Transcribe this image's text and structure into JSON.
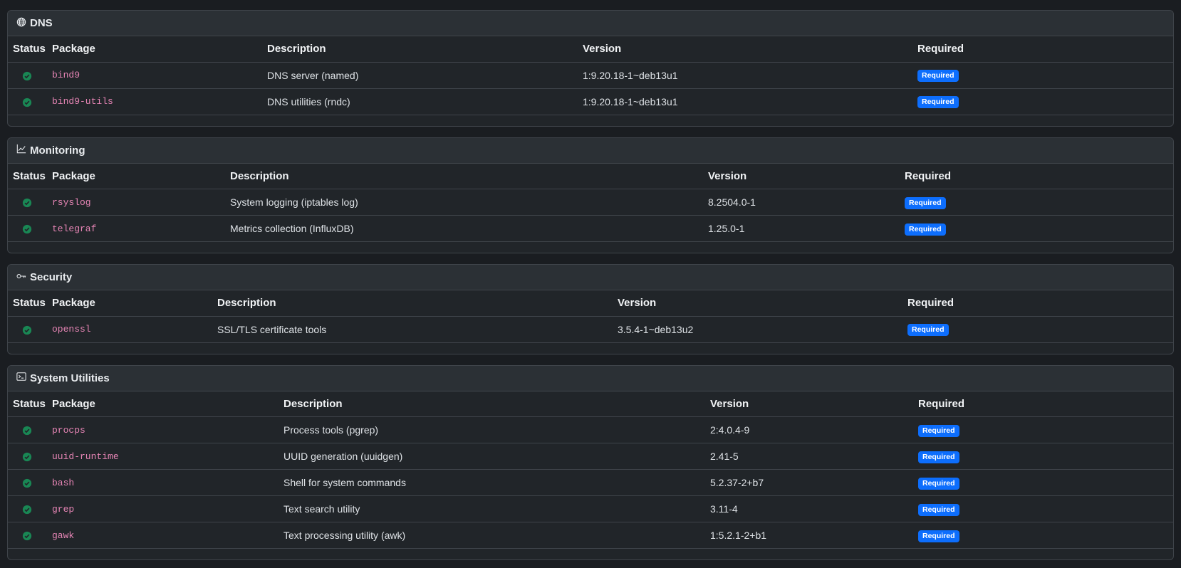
{
  "sections": [
    {
      "title": "DNS",
      "icon": "globe-icon",
      "headers": {
        "status": "Status",
        "package": "Package",
        "description": "Description",
        "version": "Version",
        "required": "Required"
      },
      "rows": [
        {
          "package": "bind9",
          "description": "DNS server (named)",
          "version": "1:9.20.18-1~deb13u1",
          "badge": "Required"
        },
        {
          "package": "bind9-utils",
          "description": "DNS utilities (rndc)",
          "version": "1:9.20.18-1~deb13u1",
          "badge": "Required"
        }
      ]
    },
    {
      "title": "Monitoring",
      "icon": "graph-up-icon",
      "headers": {
        "status": "Status",
        "package": "Package",
        "description": "Description",
        "version": "Version",
        "required": "Required"
      },
      "rows": [
        {
          "package": "rsyslog",
          "description": "System logging (iptables log)",
          "version": "8.2504.0-1",
          "badge": "Required"
        },
        {
          "package": "telegraf",
          "description": "Metrics collection (InfluxDB)",
          "version": "1.25.0-1",
          "badge": "Required"
        }
      ]
    },
    {
      "title": "Security",
      "icon": "key-icon",
      "headers": {
        "status": "Status",
        "package": "Package",
        "description": "Description",
        "version": "Version",
        "required": "Required"
      },
      "rows": [
        {
          "package": "openssl",
          "description": "SSL/TLS certificate tools",
          "version": "3.5.4-1~deb13u2",
          "badge": "Required"
        }
      ]
    },
    {
      "title": "System Utilities",
      "icon": "terminal-icon",
      "headers": {
        "status": "Status",
        "package": "Package",
        "description": "Description",
        "version": "Version",
        "required": "Required"
      },
      "rows": [
        {
          "package": "procps",
          "description": "Process tools (pgrep)",
          "version": "2:4.0.4-9",
          "badge": "Required"
        },
        {
          "package": "uuid-runtime",
          "description": "UUID generation (uuidgen)",
          "version": "2.41-5",
          "badge": "Required"
        },
        {
          "package": "bash",
          "description": "Shell for system commands",
          "version": "5.2.37-2+b7",
          "badge": "Required"
        },
        {
          "package": "grep",
          "description": "Text search utility",
          "version": "3.11-4",
          "badge": "Required"
        },
        {
          "package": "gawk",
          "description": "Text processing utility (awk)",
          "version": "1:5.2.1-2+b1",
          "badge": "Required"
        }
      ]
    }
  ],
  "colors": {
    "status_ok": "#198754",
    "badge": "#0d6efd",
    "package_text": "#e685b5"
  }
}
